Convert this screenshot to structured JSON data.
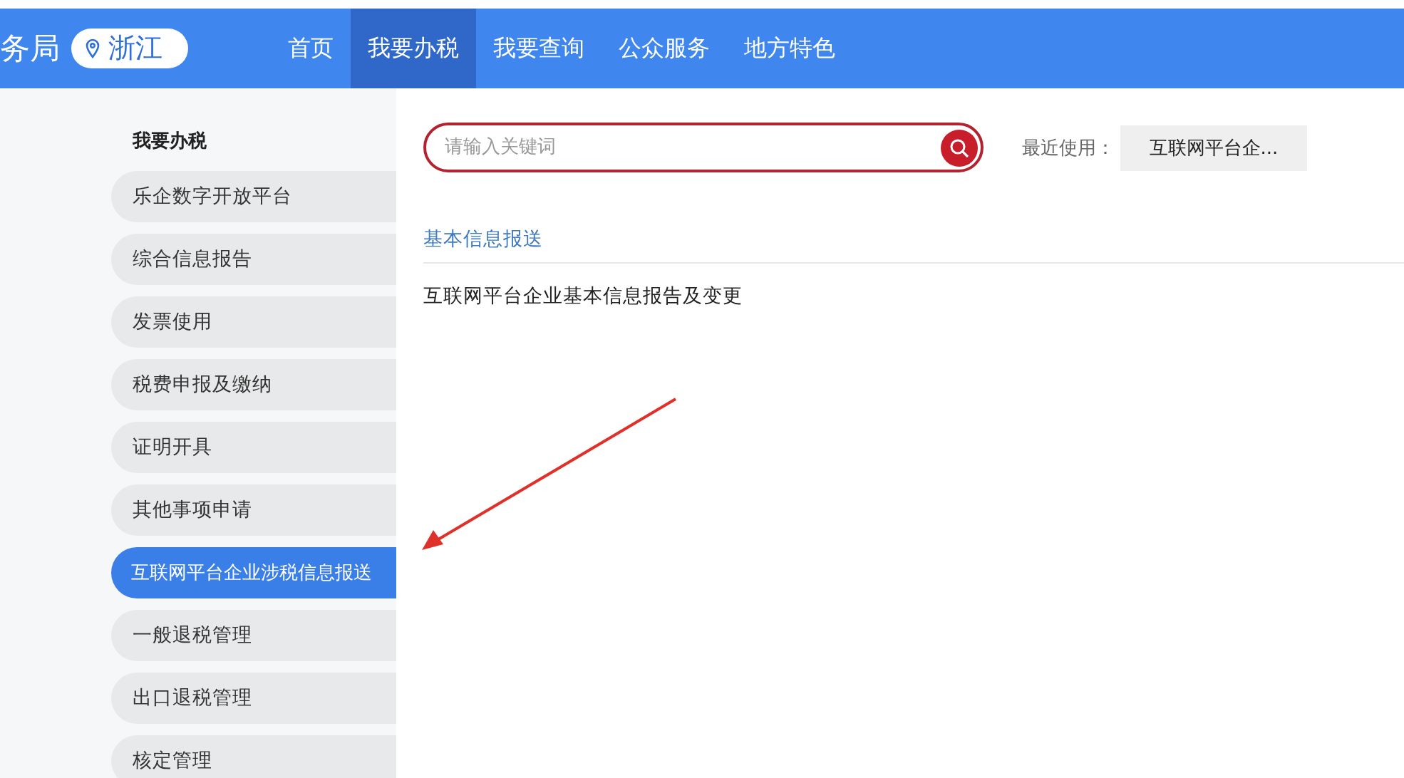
{
  "header": {
    "site_title": "务局",
    "location": "浙江",
    "nav": [
      {
        "label": "首页",
        "selected": false
      },
      {
        "label": "我要办税",
        "selected": true
      },
      {
        "label": "我要查询",
        "selected": false
      },
      {
        "label": "公众服务",
        "selected": false
      },
      {
        "label": "地方特色",
        "selected": false
      }
    ]
  },
  "sidebar": {
    "heading": "我要办税",
    "items": [
      {
        "label": "乐企数字开放平台",
        "selected": false
      },
      {
        "label": "综合信息报告",
        "selected": false
      },
      {
        "label": "发票使用",
        "selected": false
      },
      {
        "label": "税费申报及缴纳",
        "selected": false
      },
      {
        "label": "证明开具",
        "selected": false
      },
      {
        "label": "其他事项申请",
        "selected": false
      },
      {
        "label": "互联网平台企业涉税信息报送",
        "selected": true
      },
      {
        "label": "一般退税管理",
        "selected": false
      },
      {
        "label": "出口退税管理",
        "selected": false
      },
      {
        "label": "核定管理",
        "selected": false
      }
    ]
  },
  "search": {
    "placeholder": "请输入关键词"
  },
  "recent": {
    "label": "最近使用：",
    "items": [
      "互联网平台企..."
    ]
  },
  "sections": [
    {
      "title": "基本信息报送",
      "items": [
        "互联网平台企业基本信息报告及变更"
      ]
    }
  ]
}
